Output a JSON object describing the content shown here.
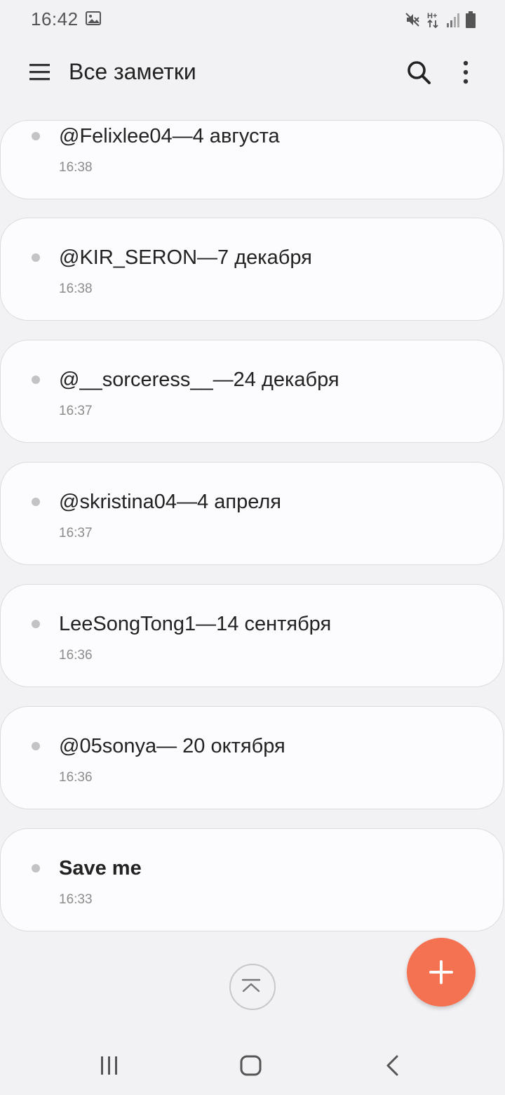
{
  "status_bar": {
    "time": "16:42",
    "icons": [
      "gallery-icon",
      "mute-icon",
      "h-plus-data-icon",
      "signal-icon",
      "battery-icon"
    ]
  },
  "app_bar": {
    "title": "Все заметки",
    "icons": [
      "menu-icon",
      "search-icon",
      "more-options-icon"
    ]
  },
  "notes": [
    {
      "title": "@Felixlee04—4 августа",
      "time": "16:38",
      "bold": false
    },
    {
      "title": "@KIR_SERON—7 декабря",
      "time": "16:38",
      "bold": false
    },
    {
      "title": "@__sorceress__—24 декабря",
      "time": "16:37",
      "bold": false
    },
    {
      "title": "@skristina04—4 апреля",
      "time": "16:37",
      "bold": false
    },
    {
      "title": "LeeSongTong1—14 сентября",
      "time": "16:36",
      "bold": false
    },
    {
      "title": "@05sonya— 20 октября",
      "time": "16:36",
      "bold": false
    },
    {
      "title": "Save me",
      "time": "16:33",
      "bold": true
    }
  ],
  "colors": {
    "background": "#f2f1f4",
    "card": "#fcfbfd",
    "fab": "#f47252",
    "text": "#222222",
    "subtext": "#8c8c8c"
  },
  "nav_bar": {
    "icons": [
      "recent-apps-icon",
      "home-icon",
      "back-icon"
    ]
  }
}
